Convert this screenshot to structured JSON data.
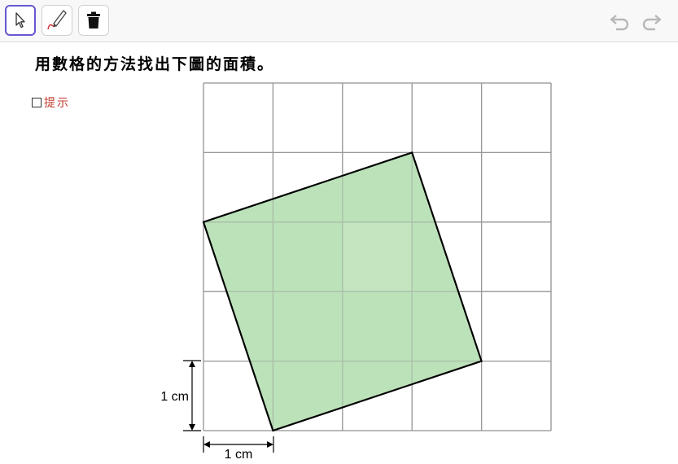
{
  "toolbar": {
    "tools": [
      {
        "name": "move-tool",
        "icon": "cursor-arrow-icon",
        "active": true
      },
      {
        "name": "pen-tool",
        "icon": "pen-icon",
        "active": false
      },
      {
        "name": "delete-tool",
        "icon": "trash-icon",
        "active": false
      }
    ],
    "history": {
      "undo_icon": "undo-icon",
      "redo_icon": "redo-icon"
    }
  },
  "question": {
    "text": "用數格的方法找出下圖的面積。"
  },
  "hint": {
    "label": "提示",
    "checked": false
  },
  "figure": {
    "grid": {
      "columns": 5,
      "rows": 5,
      "cell_unit_cm": 1
    },
    "square_vertices": [
      [
        3,
        4
      ],
      [
        4,
        1
      ],
      [
        1,
        0
      ],
      [
        0,
        3
      ]
    ],
    "fill_color": "#b8e0b5",
    "center_highlight_color": "#c9e8c5",
    "stroke_color": "#000000",
    "grid_color": "#999999",
    "vertical_dimension_label": "1 cm",
    "horizontal_dimension_label": "1 cm"
  }
}
